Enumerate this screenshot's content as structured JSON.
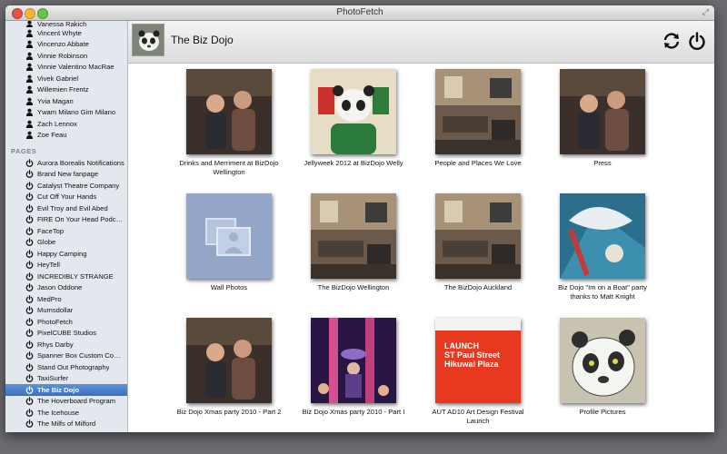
{
  "window": {
    "title": "PhotoFetch"
  },
  "sidebar": {
    "people": [
      "Vanessa Rakich",
      "Vincent Whyte",
      "Vincenzo Abbate",
      "Vinnie Robinson",
      "Vinnie Valentino MacRae",
      "Vivek Gabriel",
      "Willemien Frentz",
      "Yvia Magan",
      "Ywam Milano Gim Milano",
      "Zach Lennox",
      "Zoe Feau"
    ],
    "pages_header": "PAGES",
    "pages": [
      "Aurora Borealis Notifications",
      "Brand New fanpage",
      "Catalyst Theatre Company",
      "Cut Off Your Hands",
      "Evil Troy and Evil Abed",
      "FIRE On Your Head Podcast",
      "FaceTop",
      "Globe",
      "Happy Camping",
      "HeyTell",
      "INCREDIBLY STRANGE",
      "Jason Oddone",
      "MedPro",
      "Mumsdollar",
      "PhotoFetch",
      "PixelCUBE Studios",
      "Rhys Darby",
      "Spanner Box Custom Com...",
      "Stand Out Photography",
      "TaxiSurfer",
      "The Biz Dojo",
      "The Hoverboard Program",
      "The Icehouse",
      "The Milfs of Milford"
    ],
    "selected": "The Biz Dojo"
  },
  "main": {
    "page_title": "The Biz Dojo",
    "albums": [
      {
        "title": "Drinks and Merriment at BizDojo Wellington",
        "scene": "people"
      },
      {
        "title": "Jellyweek 2012 at BizDojo Welly",
        "scene": "panda-room"
      },
      {
        "title": "People and Places We Love",
        "scene": "room"
      },
      {
        "title": "Press",
        "scene": "people"
      },
      {
        "title": "Wall Photos",
        "scene": "placeholder"
      },
      {
        "title": "The BizDojo Wellington",
        "scene": "room"
      },
      {
        "title": "The BizDojo Auckland",
        "scene": "room"
      },
      {
        "title": "Biz Dojo \"Im on a Boat\" party thanks to Matt Knight",
        "scene": "art"
      },
      {
        "title": "Biz Dojo Xmas party 2010 - Part 2",
        "scene": "people"
      },
      {
        "title": "Biz Dojo Xmas party 2010 - Part I",
        "scene": "party"
      },
      {
        "title": "AUT AD10 Art  Design Festival Launch",
        "scene": "poster"
      },
      {
        "title": "Profile Pictures",
        "scene": "panda"
      }
    ]
  },
  "poster": {
    "line1": "LAUNCH",
    "line2": "ST Paul Street",
    "line3": "Hikuwai Plaza"
  },
  "colors": {
    "selection": "#3a6fbf",
    "sidebar_bg": "#e3e8ee"
  },
  "icons": {
    "person": "person-icon",
    "page": "page-power-icon",
    "refresh": "refresh-icon",
    "power": "power-icon"
  }
}
